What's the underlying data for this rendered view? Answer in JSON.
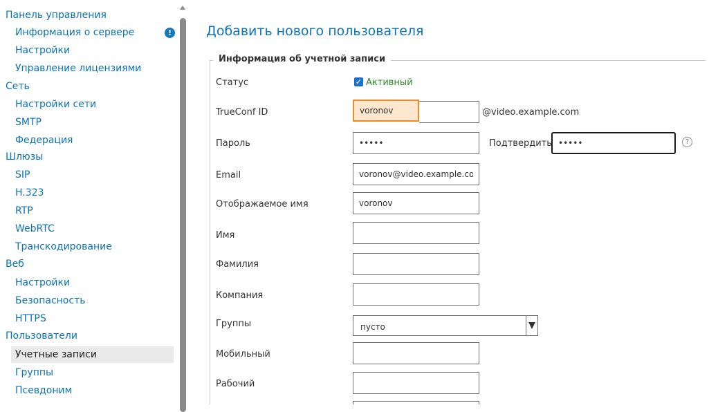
{
  "sidebar": {
    "sections": [
      {
        "label": "Панель управления",
        "items": [
          "Информация о сервере",
          "Настройки",
          "Управление лицензиями"
        ]
      },
      {
        "label": "Сеть",
        "items": [
          "Настройки сети",
          "SMTP",
          "Федерация"
        ]
      },
      {
        "label": "Шлюзы",
        "items": [
          "SIP",
          "H.323",
          "RTP",
          "WebRTC",
          "Транскодирование"
        ]
      },
      {
        "label": "Веб",
        "items": [
          "Настройки",
          "Безопасность",
          "HTTPS"
        ]
      },
      {
        "label": "Пользователи",
        "items": [
          "Учетные записи",
          "Группы",
          "Псевдоним"
        ]
      }
    ],
    "active_item": "Учетные записи",
    "warning_icon": "exclamation-circle-icon",
    "warning_glyph": "!"
  },
  "main": {
    "title": "Добавить нового пользователя",
    "fieldset_legend": "Информация об учетной записи",
    "status": {
      "label": "Статус",
      "checked": true,
      "checkbox_text": "Активный",
      "check_glyph": "✓"
    },
    "trueconf_id": {
      "label": "TrueConf ID",
      "value": "voronov",
      "suffix": "@video.example.com"
    },
    "password": {
      "label": "Пароль",
      "value": "•••••",
      "confirm_label": "Подтвердить",
      "confirm_value": "•••••",
      "help_glyph": "?"
    },
    "email": {
      "label": "Email",
      "value": "voronov@video.example.com"
    },
    "display_name": {
      "label": "Отображаемое имя",
      "value": "voronov"
    },
    "first_name": {
      "label": "Имя",
      "value": ""
    },
    "last_name": {
      "label": "Фамилия",
      "value": ""
    },
    "company": {
      "label": "Компания",
      "value": ""
    },
    "groups": {
      "label": "Группы",
      "value": "пусто"
    },
    "mobile": {
      "label": "Мобильный",
      "value": ""
    },
    "work": {
      "label": "Рабочий",
      "value": ""
    }
  },
  "colors": {
    "link": "#0a73b5",
    "active_green": "#2a8a2a",
    "highlight_border": "#f08a23",
    "highlight_fill": "#fde7cf",
    "active_bg": "#eaeaea"
  }
}
